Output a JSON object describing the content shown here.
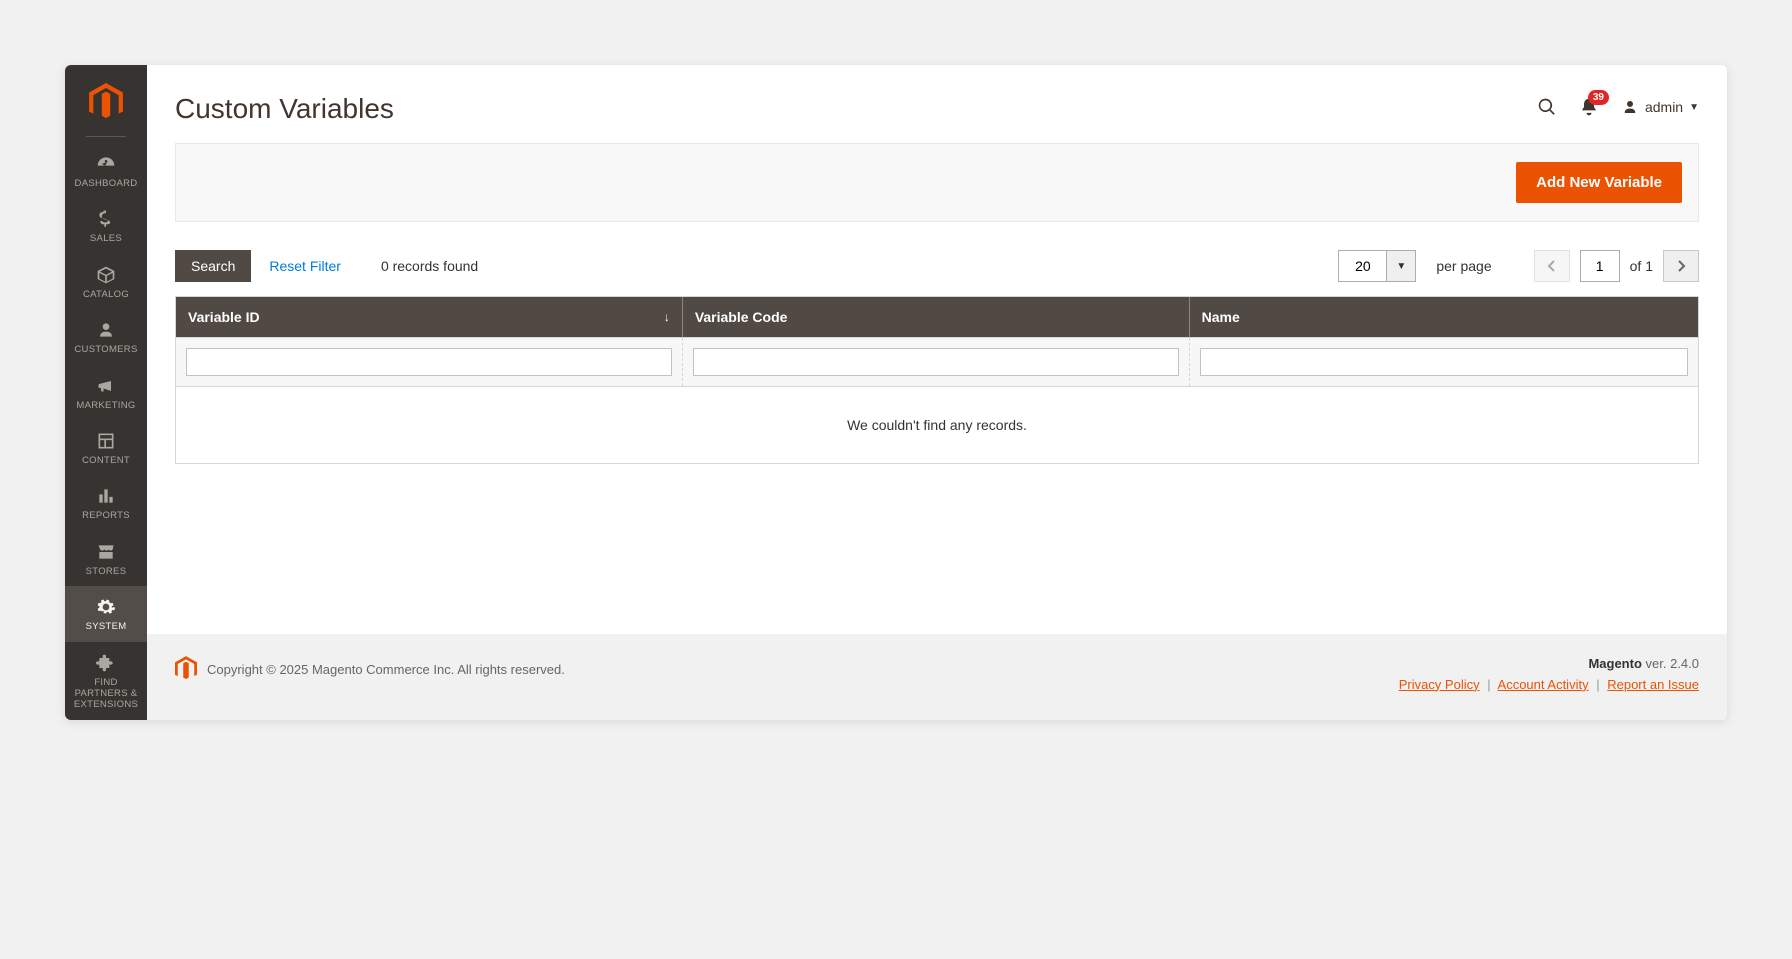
{
  "sidebar": {
    "items": [
      {
        "label": "DASHBOARD"
      },
      {
        "label": "SALES"
      },
      {
        "label": "CATALOG"
      },
      {
        "label": "CUSTOMERS"
      },
      {
        "label": "MARKETING"
      },
      {
        "label": "CONTENT"
      },
      {
        "label": "REPORTS"
      },
      {
        "label": "STORES"
      },
      {
        "label": "SYSTEM"
      },
      {
        "label": "FIND PARTNERS & EXTENSIONS"
      }
    ]
  },
  "header": {
    "title": "Custom Variables",
    "notifications_count": "39",
    "user_label": "admin"
  },
  "actions": {
    "add_new_label": "Add New Variable"
  },
  "toolbar": {
    "search_label": "Search",
    "reset_label": "Reset Filter",
    "records_text": "0 records found",
    "per_page_value": "20",
    "per_page_label": "per page",
    "page_value": "1",
    "page_total_text": "of 1"
  },
  "grid": {
    "columns": {
      "id": "Variable ID",
      "code": "Variable Code",
      "name": "Name"
    },
    "empty_text": "We couldn't find any records."
  },
  "footer": {
    "copyright": "Copyright © 2025 Magento Commerce Inc. All rights reserved.",
    "app_name": "Magento",
    "version_text": " ver. 2.4.0",
    "links": {
      "privacy": "Privacy Policy",
      "activity": "Account Activity",
      "report": "Report an Issue"
    }
  }
}
